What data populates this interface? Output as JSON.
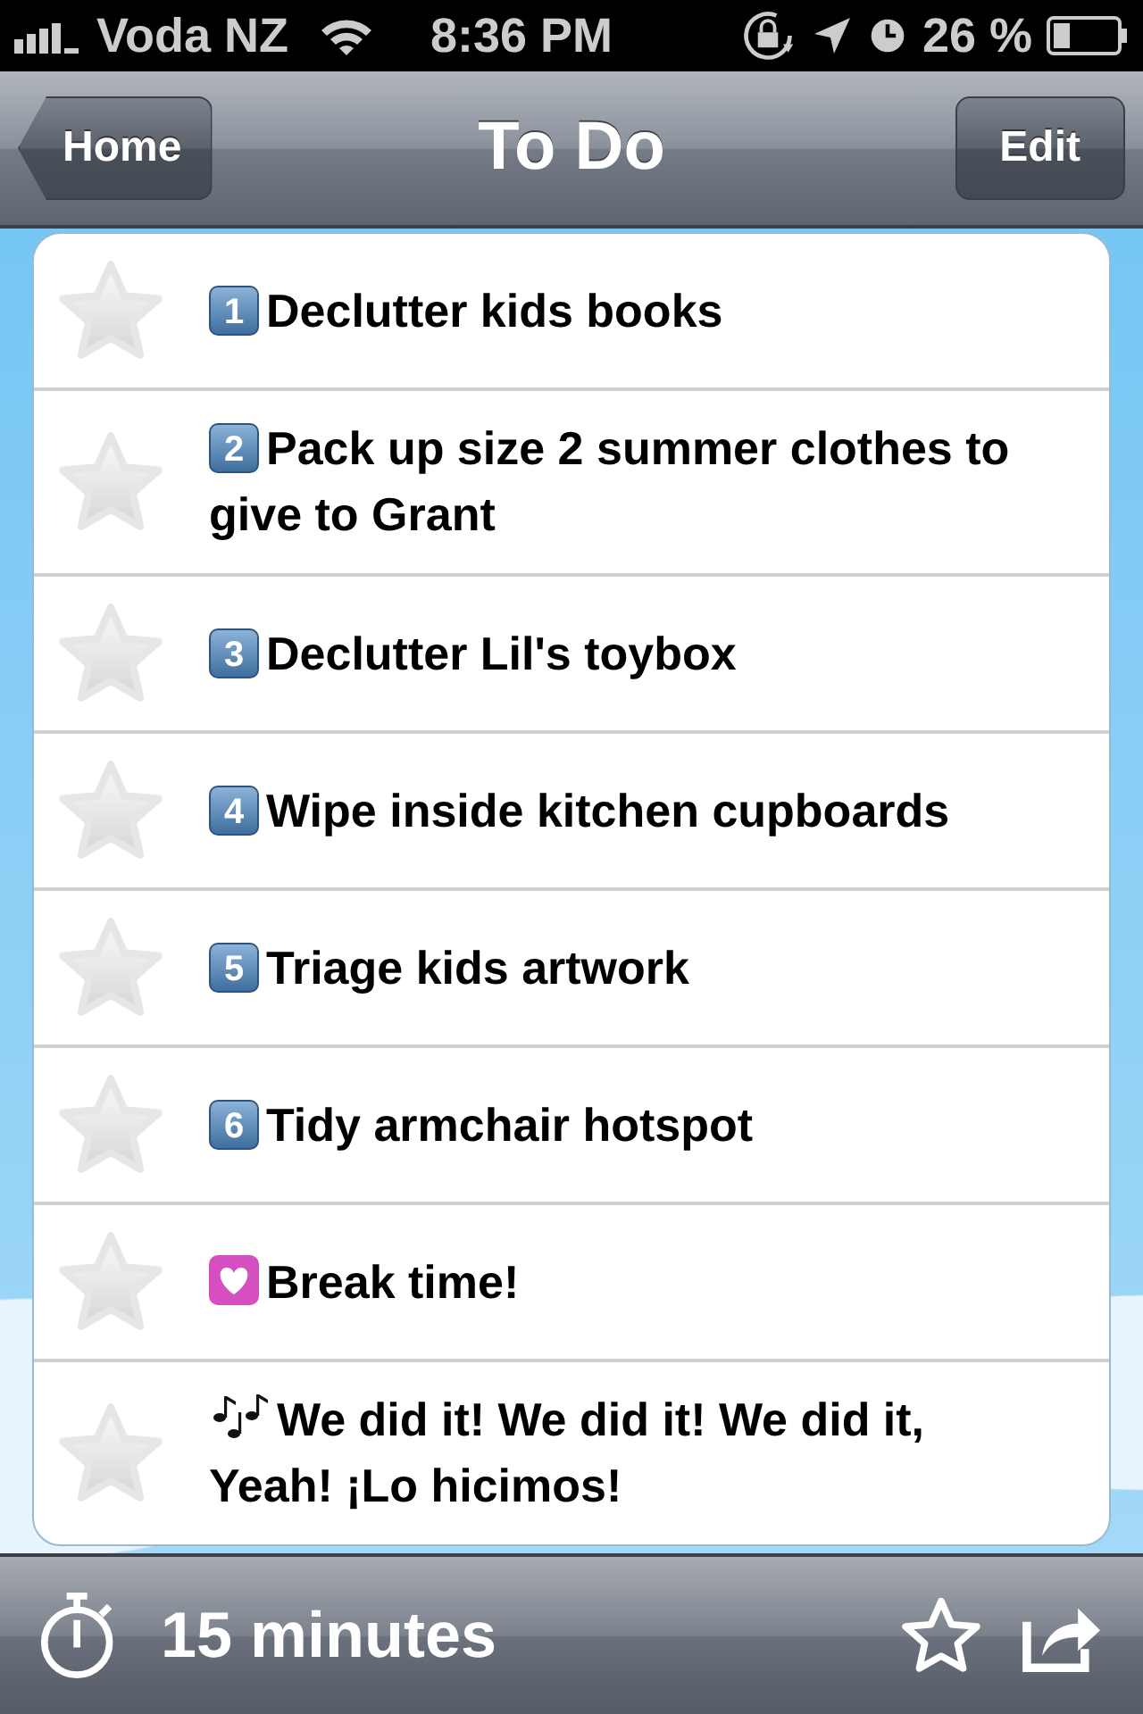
{
  "status_bar": {
    "carrier": "Voda NZ",
    "time": "8:36 PM",
    "battery": "26 %"
  },
  "nav_bar": {
    "back": "Home",
    "title": "To Do",
    "action": "Edit"
  },
  "tasks": [
    {
      "marker": {
        "kind": "keycap",
        "label": "1"
      },
      "text": "Declutter kids books",
      "starred": false
    },
    {
      "marker": {
        "kind": "keycap",
        "label": "2"
      },
      "text": "Pack up size 2 summer clothes to give to Grant",
      "starred": false
    },
    {
      "marker": {
        "kind": "keycap",
        "label": "3"
      },
      "text": "Declutter Lil's toybox",
      "starred": false
    },
    {
      "marker": {
        "kind": "keycap",
        "label": "4"
      },
      "text": "Wipe inside kitchen cupboards",
      "starred": false
    },
    {
      "marker": {
        "kind": "keycap",
        "label": "5"
      },
      "text": "Triage kids artwork",
      "starred": false
    },
    {
      "marker": {
        "kind": "keycap",
        "label": "6"
      },
      "text": "Tidy armchair hotspot",
      "starred": false
    },
    {
      "marker": {
        "kind": "heart"
      },
      "text": "Break time!",
      "starred": false
    },
    {
      "marker": {
        "kind": "notes"
      },
      "text": "We did it! We did it! We did it, Yeah! ¡Lo hicimos!",
      "starred": false
    }
  ],
  "toolbar": {
    "duration": "15 minutes"
  }
}
